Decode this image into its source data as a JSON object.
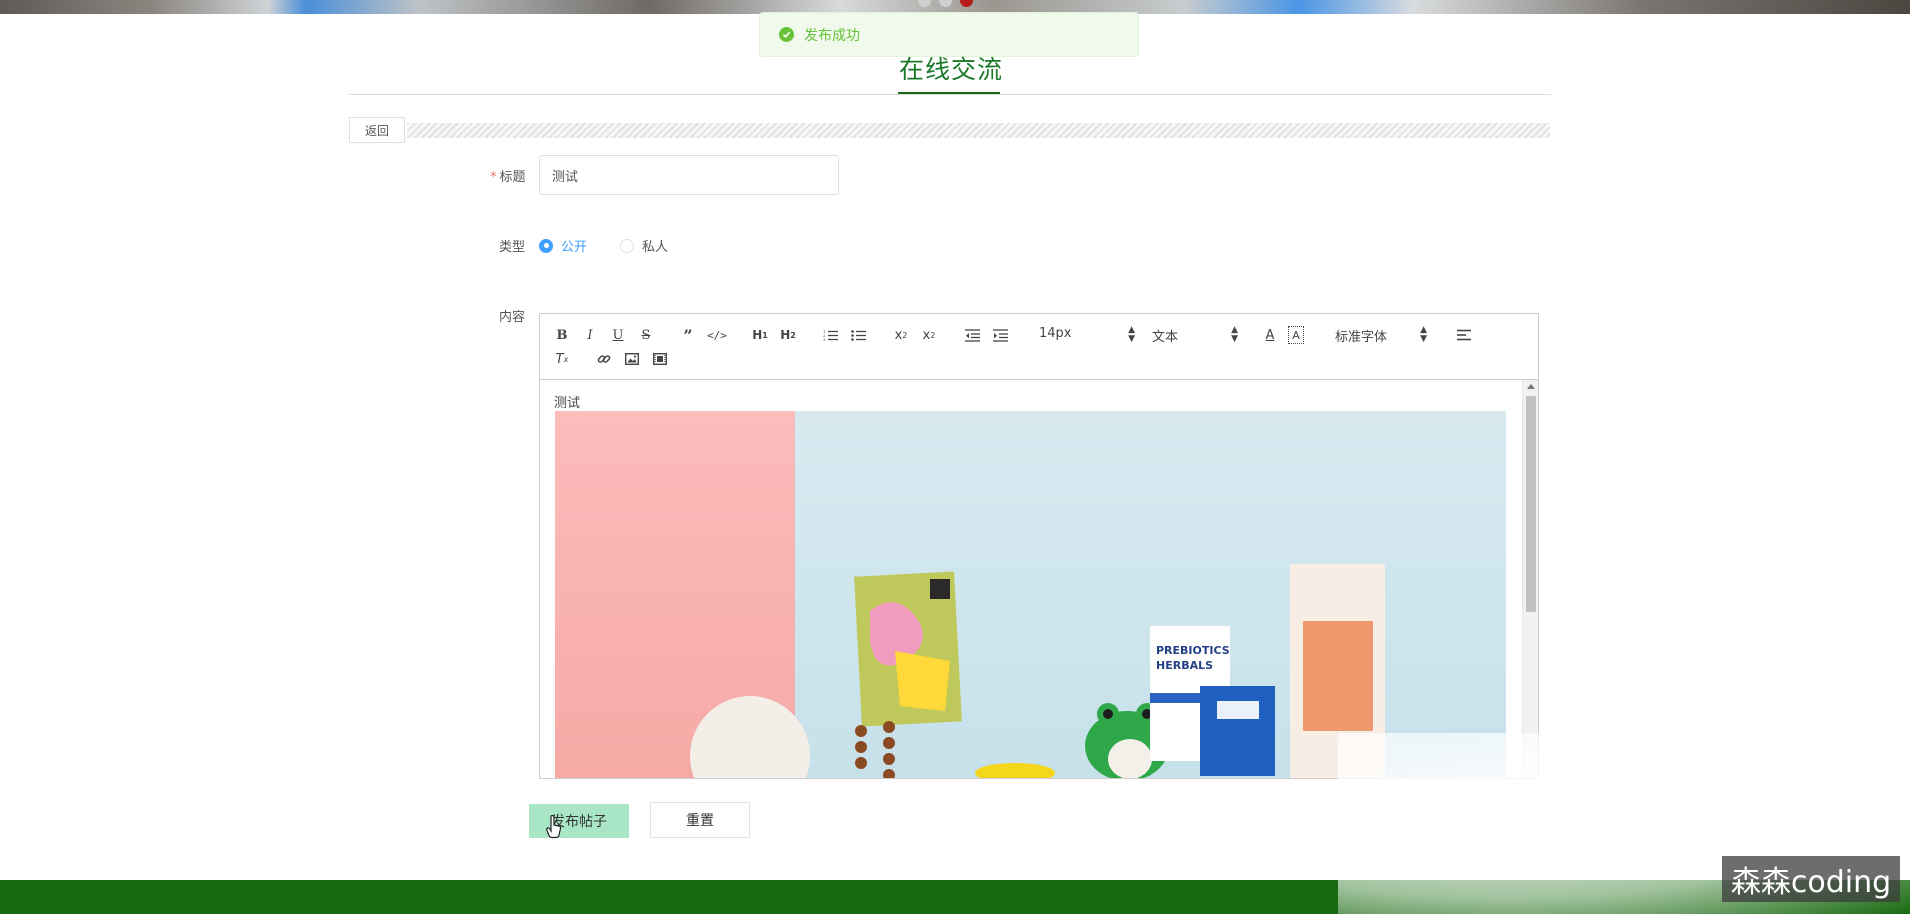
{
  "toast": {
    "message": "发布成功",
    "icon": "check-circle-icon",
    "color": "#67c23a"
  },
  "header": {
    "title": "在线交流",
    "accent_color": "#1a7a2a"
  },
  "back_label": "返回",
  "form": {
    "title_label": "标题",
    "title_value": "测试",
    "type_label": "类型",
    "type_options": [
      {
        "label": "公开",
        "selected": true
      },
      {
        "label": "私人",
        "selected": false
      }
    ],
    "content_label": "内容"
  },
  "editor": {
    "font_size": "14px",
    "block_format": "文本",
    "font_family": "标准字体",
    "content_text": "测试"
  },
  "buttons": {
    "submit": "发布帖子",
    "reset": "重置"
  },
  "watermark": "森森coding",
  "colors": {
    "footer": "#186a10",
    "submit_bg": "#a8e6c6",
    "radio_selected": "#409eff"
  }
}
